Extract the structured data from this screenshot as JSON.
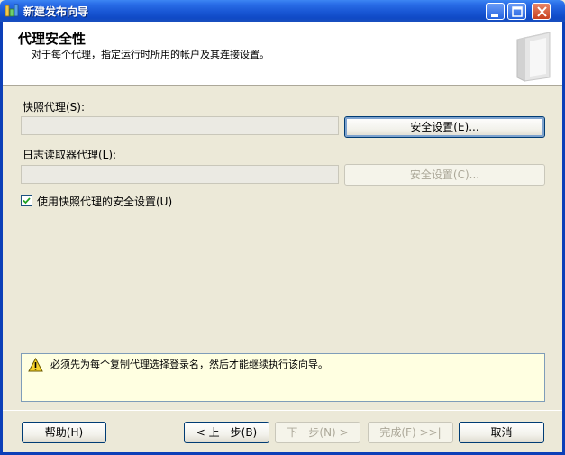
{
  "window": {
    "title": "新建发布向导"
  },
  "header": {
    "title": "代理安全性",
    "description": "对于每个代理，指定运行时所用的帐户及其连接设置。"
  },
  "snapshot_agent": {
    "label": "快照代理(S):",
    "value": "",
    "button_label": "安全设置(E)..."
  },
  "logreader_agent": {
    "label": "日志读取器代理(L):",
    "value": "",
    "button_label": "安全设置(C)..."
  },
  "use_snapshot_security": {
    "label": "使用快照代理的安全设置(U)",
    "checked": true
  },
  "message": {
    "text": "必须先为每个复制代理选择登录名，然后才能继续执行该向导。"
  },
  "footer": {
    "help": "帮助(H)",
    "back": "< 上一步(B)",
    "next": "下一步(N) >",
    "finish": "完成(F) >>|",
    "cancel": "取消"
  }
}
